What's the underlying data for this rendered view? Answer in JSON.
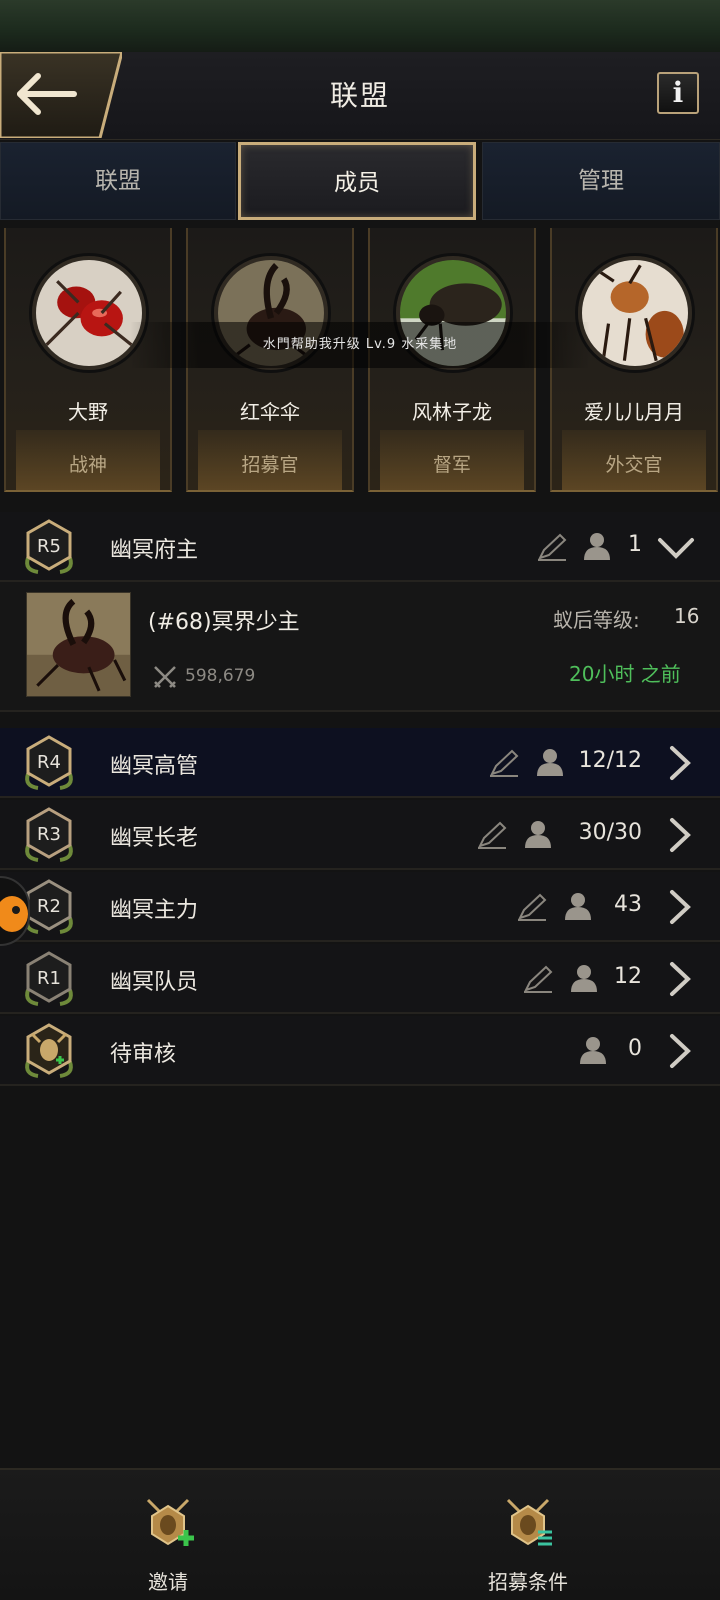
{
  "header": {
    "title": "联盟",
    "info_label": "i"
  },
  "tabs": [
    {
      "label": "联盟",
      "active": false
    },
    {
      "label": "成员",
      "active": true
    },
    {
      "label": "管理",
      "active": false
    }
  ],
  "officers": [
    {
      "name": "大野",
      "role": "战神"
    },
    {
      "name": "红伞伞",
      "role": "招募官"
    },
    {
      "name": "风林子龙",
      "role": "督军"
    },
    {
      "name": "爱儿儿月月",
      "role": "外交官"
    }
  ],
  "banner_text": "水門帮助我升级 Lv.9 水采集地",
  "ranks": {
    "r5": {
      "badge": "R5",
      "name": "幽冥府主",
      "count": "1",
      "expanded": true
    },
    "r4": {
      "badge": "R4",
      "name": "幽冥高管",
      "count": "12/12"
    },
    "r3": {
      "badge": "R3",
      "name": "幽冥长老",
      "count": "30/30"
    },
    "r2": {
      "badge": "R2",
      "name": "幽冥主力",
      "count": "43"
    },
    "r1": {
      "badge": "R1",
      "name": "幽冥队员",
      "count": "12"
    },
    "pending": {
      "name": "待审核",
      "count": "0"
    }
  },
  "leader": {
    "name": "(#68)冥界少主",
    "power": "598,679",
    "queen_label": "蚁后等级:",
    "queen_level": "16",
    "last_online": "20小时 之前"
  },
  "bottom": {
    "invite_label": "邀请",
    "recruit_label": "招募条件"
  },
  "colors": {
    "accent_gold": "#c9ad7b",
    "online_green": "#4fbf5b",
    "background": "#131313"
  },
  "icons": [
    "back-arrow-icon",
    "info-icon",
    "pencil-icon",
    "person-icon",
    "chevron-right-icon",
    "chevron-down-icon",
    "crossed-swords-icon",
    "ant-invite-icon",
    "ant-recruit-icon"
  ]
}
